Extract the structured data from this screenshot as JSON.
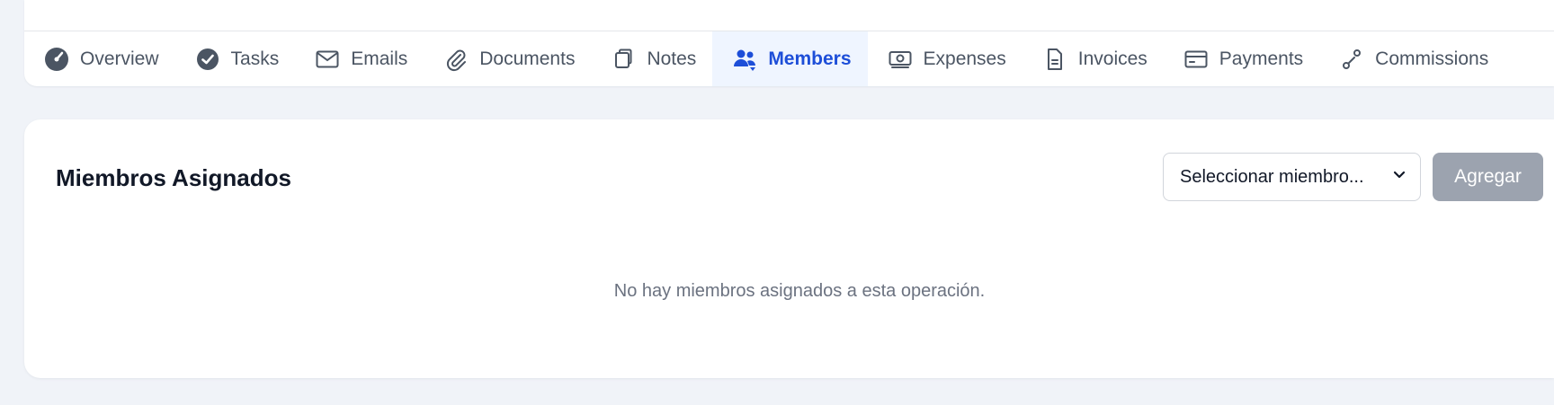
{
  "tabs": [
    {
      "label": "Overview",
      "icon": "gauge-icon"
    },
    {
      "label": "Tasks",
      "icon": "check-circle-icon"
    },
    {
      "label": "Emails",
      "icon": "envelope-icon"
    },
    {
      "label": "Documents",
      "icon": "paperclip-icon"
    },
    {
      "label": "Notes",
      "icon": "note-icon"
    },
    {
      "label": "Members",
      "icon": "users-icon"
    },
    {
      "label": "Expenses",
      "icon": "money-icon"
    },
    {
      "label": "Invoices",
      "icon": "file-icon"
    },
    {
      "label": "Payments",
      "icon": "credit-card-icon"
    },
    {
      "label": "Commissions",
      "icon": "percent-icon"
    }
  ],
  "active_tab": "Members",
  "members_card": {
    "title": "Miembros Asignados",
    "select_value": "Seleccionar miembro...",
    "add_label": "Agregar",
    "empty_message": "No hay miembros asignados a esta operación."
  },
  "colors": {
    "accent": "#1d4ed8",
    "active_tab_bg": "#eff5ff",
    "page_bg": "#f0f3f8",
    "disabled_button": "#9ca3af"
  }
}
